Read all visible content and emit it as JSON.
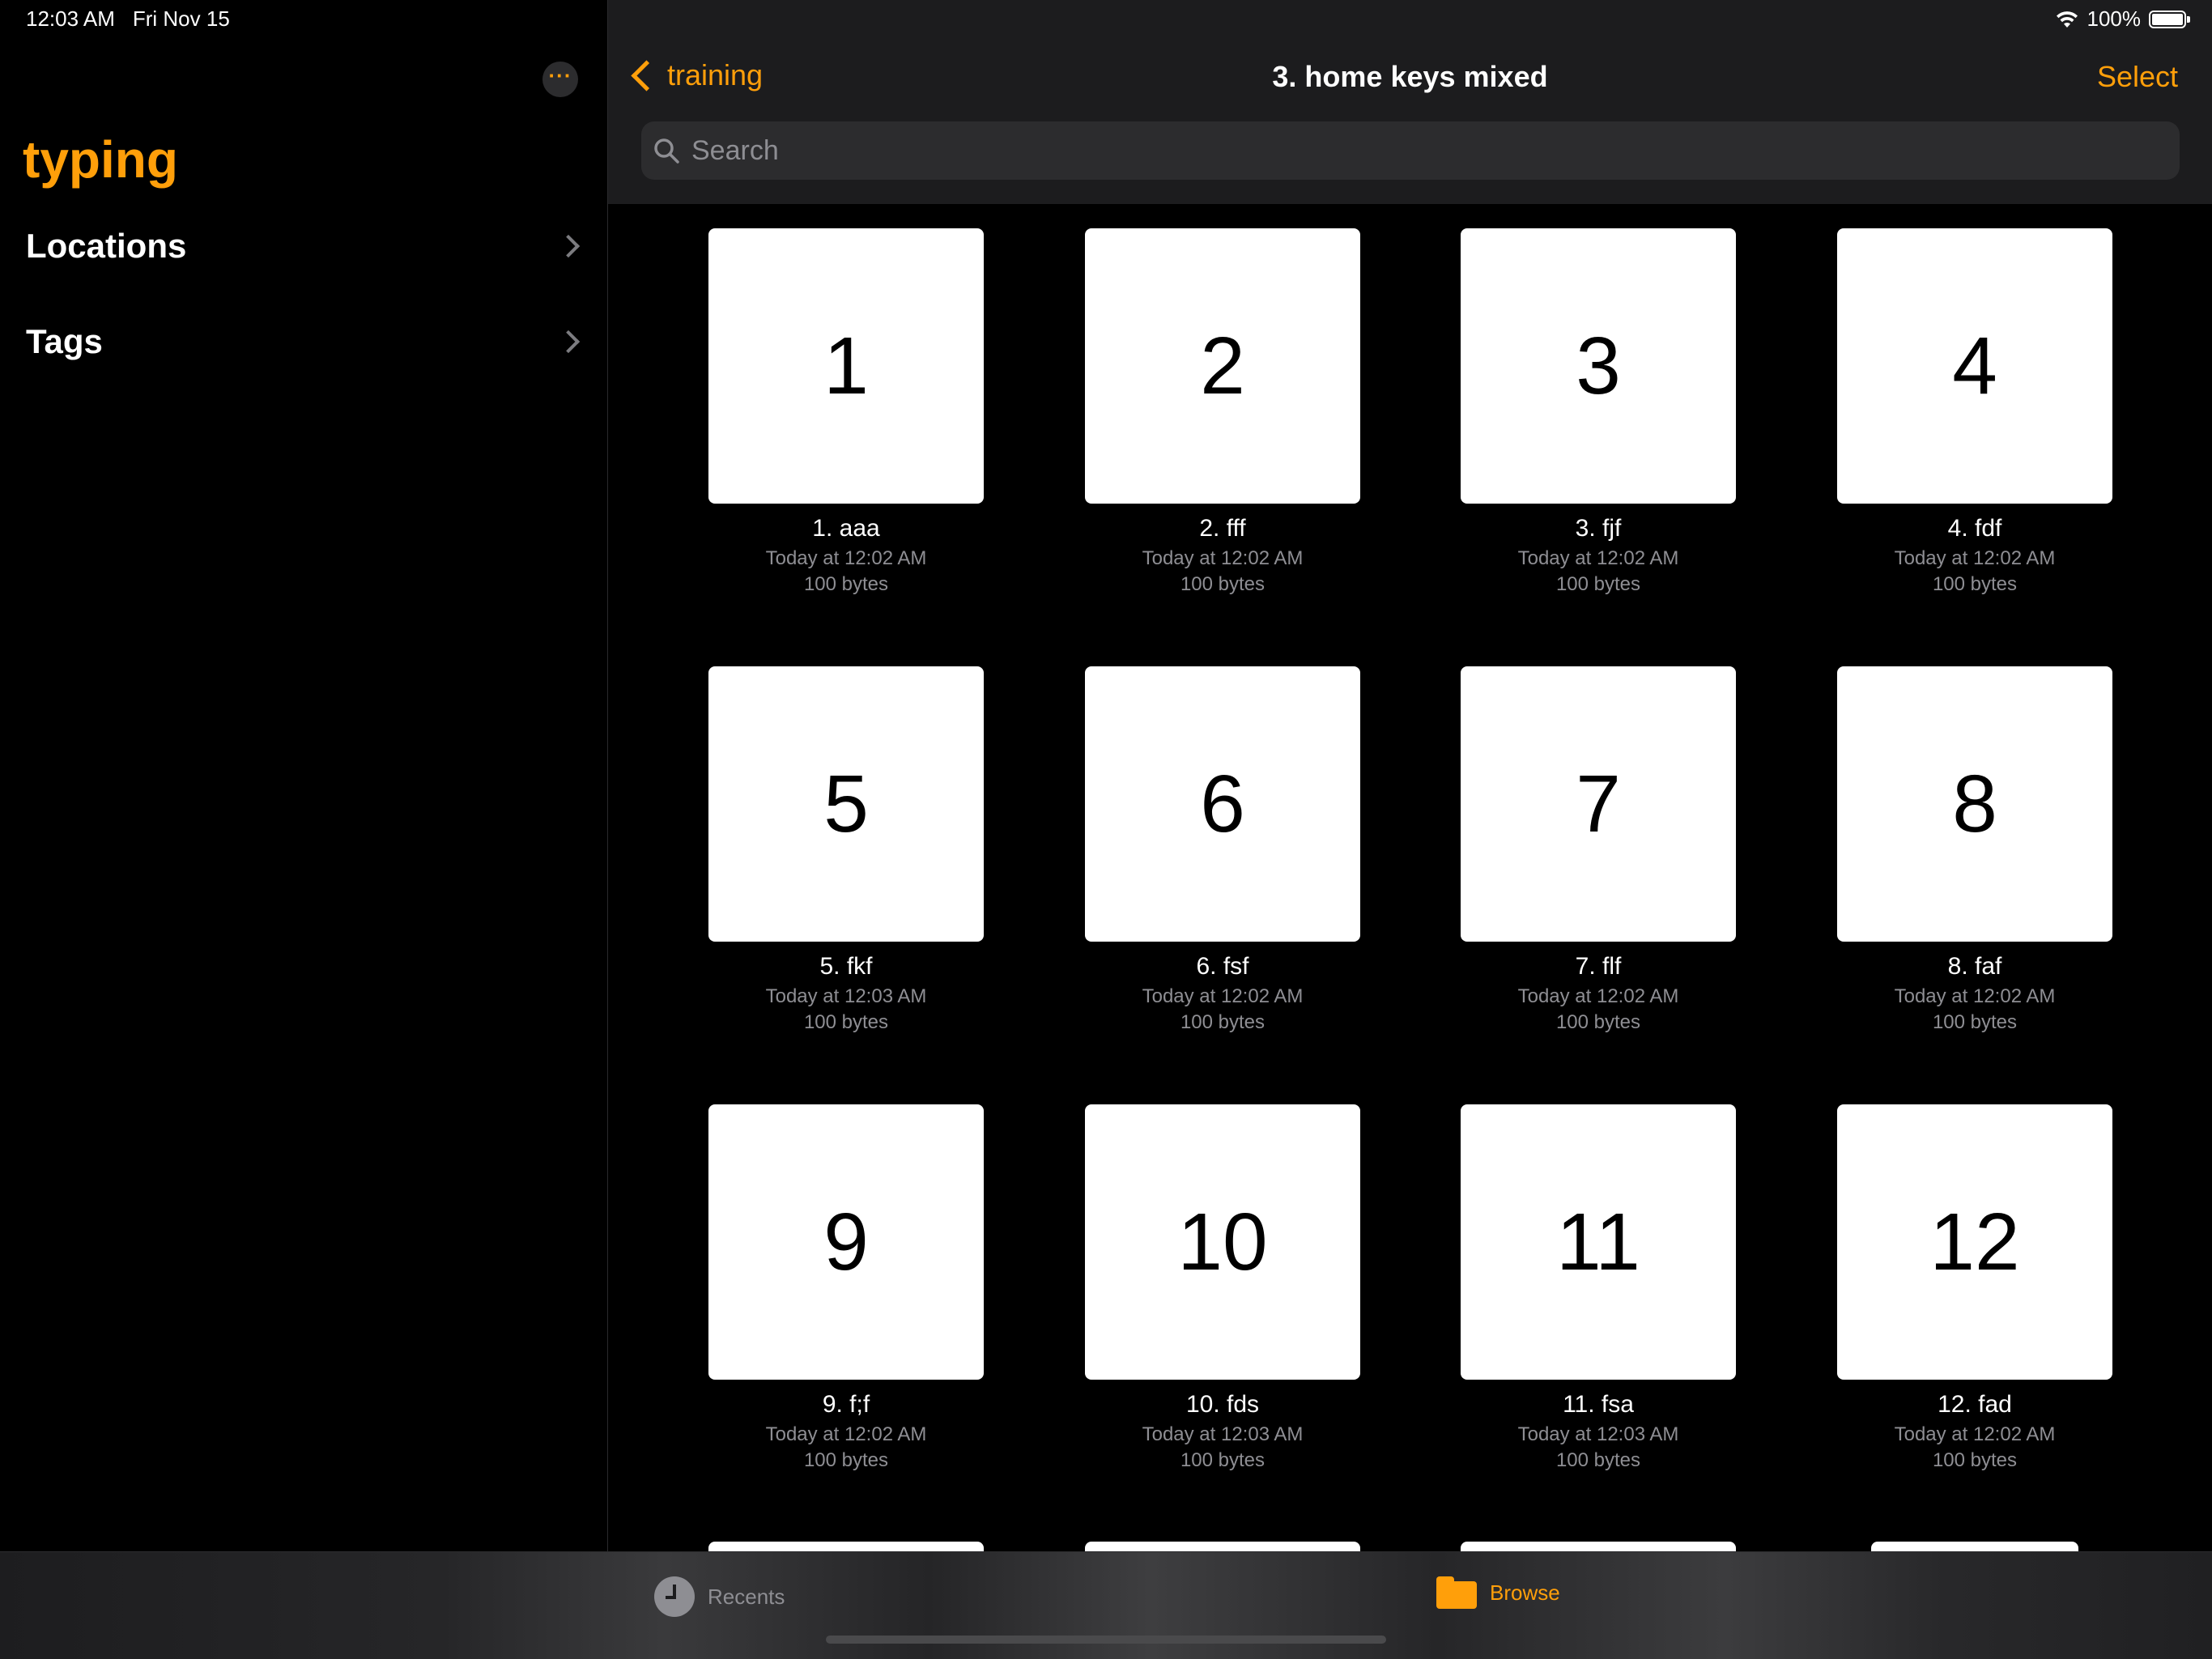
{
  "status_bar": {
    "time": "12:03 AM",
    "date": "Fri Nov 15",
    "battery": "100%"
  },
  "sidebar": {
    "title": "typing",
    "items": [
      {
        "label": "Locations"
      },
      {
        "label": "Tags"
      }
    ]
  },
  "header": {
    "back_label": "training",
    "title": "3. home keys mixed",
    "select_label": "Select"
  },
  "search": {
    "placeholder": "Search"
  },
  "files": [
    {
      "thumb": "1",
      "name": "1. aaa",
      "date": "Today at 12:02 AM",
      "size": "100 bytes"
    },
    {
      "thumb": "2",
      "name": "2. fff",
      "date": "Today at 12:02 AM",
      "size": "100 bytes"
    },
    {
      "thumb": "3",
      "name": "3. fjf",
      "date": "Today at 12:02 AM",
      "size": "100 bytes"
    },
    {
      "thumb": "4",
      "name": "4. fdf",
      "date": "Today at 12:02 AM",
      "size": "100 bytes"
    },
    {
      "thumb": "5",
      "name": "5. fkf",
      "date": "Today at 12:03 AM",
      "size": "100 bytes"
    },
    {
      "thumb": "6",
      "name": "6. fsf",
      "date": "Today at 12:02 AM",
      "size": "100 bytes"
    },
    {
      "thumb": "7",
      "name": "7. flf",
      "date": "Today at 12:02 AM",
      "size": "100 bytes"
    },
    {
      "thumb": "8",
      "name": "8. faf",
      "date": "Today at 12:02 AM",
      "size": "100 bytes"
    },
    {
      "thumb": "9",
      "name": "9. f;f",
      "date": "Today at 12:02 AM",
      "size": "100 bytes"
    },
    {
      "thumb": "10",
      "name": "10. fds",
      "date": "Today at 12:03 AM",
      "size": "100 bytes"
    },
    {
      "thumb": "11",
      "name": "11. fsa",
      "date": "Today at 12:03 AM",
      "size": "100 bytes"
    },
    {
      "thumb": "12",
      "name": "12. fad",
      "date": "Today at 12:02 AM",
      "size": "100 bytes"
    }
  ],
  "tabs": {
    "recents": "Recents",
    "browse": "Browse"
  },
  "colors": {
    "accent": "#ff9f0a",
    "background": "#000000",
    "header_bg": "#1c1c1e",
    "secondary_text": "#8e8e93"
  }
}
